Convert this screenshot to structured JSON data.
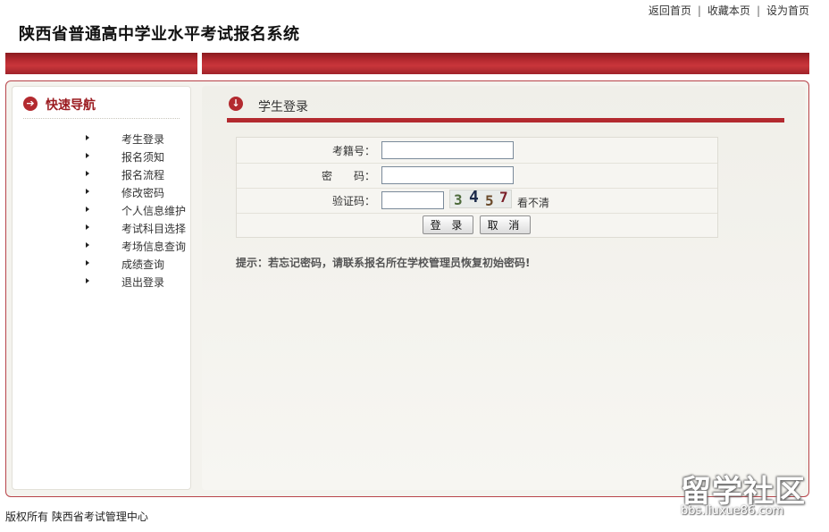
{
  "top_links": [
    "返回首页",
    "收藏本页",
    "设为首页"
  ],
  "site_title": "陕西省普通高中学业水平考试报名系统",
  "sidebar": {
    "title": "快速导航",
    "items": [
      "考生登录",
      "报名须知",
      "报名流程",
      "修改密码",
      "个人信息维护",
      "考试科目选择",
      "考场信息查询",
      "成绩查询",
      "退出登录"
    ]
  },
  "main": {
    "title": "学生登录",
    "form": {
      "exam_id_label": "考籍号：",
      "exam_id_value": "",
      "password_label": "密　　码：",
      "password_value": "",
      "captcha_label": "验证码：",
      "captcha_value": "",
      "captcha_text": [
        "3",
        "4",
        "5",
        "7"
      ],
      "captcha_refresh": "看不清",
      "login_button": "登 录",
      "cancel_button": "取 消"
    },
    "tip": "提示：若忘记密码，请联系报名所在学校管理员恢复初始密码!"
  },
  "footer": "版权所有  陕西省考试管理中心",
  "watermark": {
    "big": "留学社区",
    "small": "bbs.liuxue86.com"
  },
  "colors": {
    "accent": "#b32a2f",
    "band": "#c9363b",
    "frame_border": "#b8444a"
  },
  "icons": {
    "sidebar_head": "arrow-right-circle-icon",
    "main_head": "arrow-down-circle-icon",
    "nav_bullet": "triangle-right-icon"
  }
}
